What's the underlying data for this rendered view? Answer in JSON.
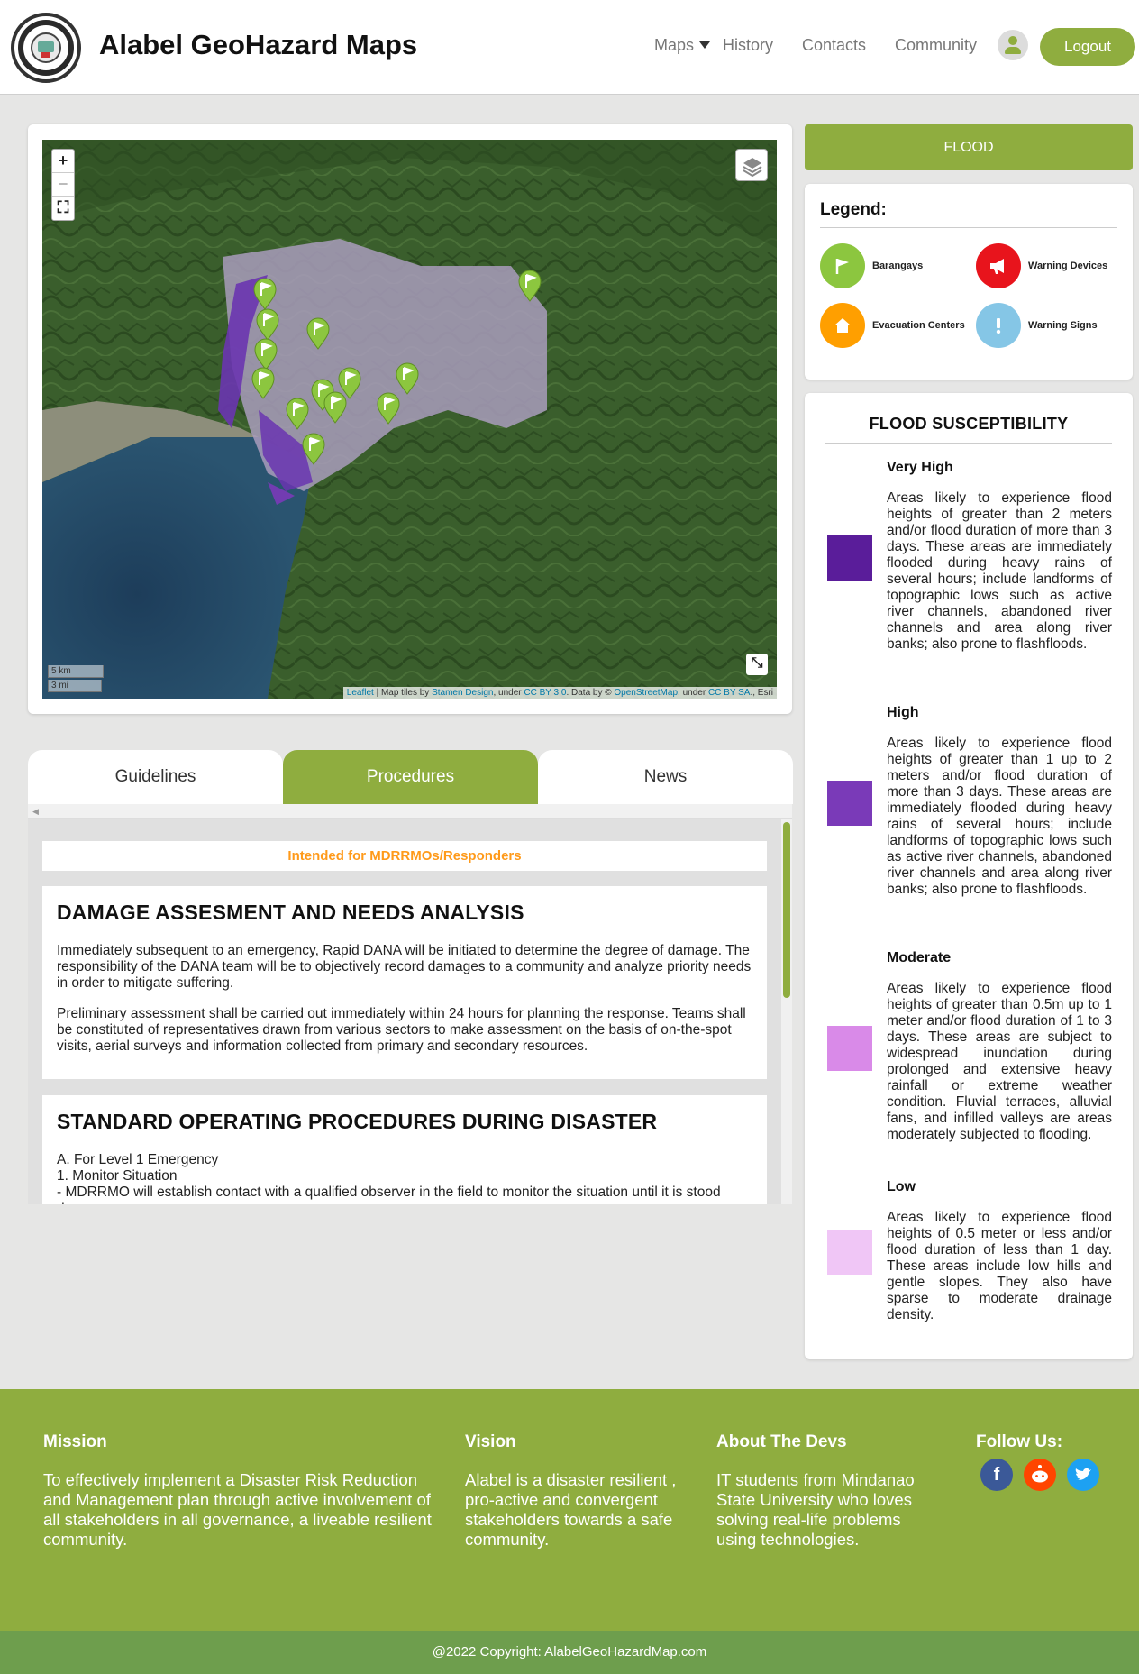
{
  "header": {
    "site_title": "Alabel GeoHazard Maps",
    "nav": {
      "maps": "Maps",
      "history": "History",
      "contacts": "Contacts",
      "community": "Community"
    },
    "logout": "Logout"
  },
  "map": {
    "zoom_in": "+",
    "zoom_out": "−",
    "scale_km": "5 km",
    "scale_mi": "3 mi",
    "attribution": {
      "leaflet": "Leaflet",
      "sep1": " | Map tiles by ",
      "stamen": "Stamen Design",
      "sep2": ", under ",
      "ccby": "CC BY 3.0",
      "sep3": ". Data by © ",
      "osm": "OpenStreetMap",
      "sep4": ", under ",
      "ccbysa": "CC BY SA",
      "sep5": "., Esri"
    }
  },
  "tabs": {
    "guidelines": "Guidelines",
    "procedures": "Procedures",
    "news": "News"
  },
  "procedures": {
    "intended": "Intended for MDRRMOs/Responders",
    "section1": {
      "title": "DAMAGE ASSESMENT AND NEEDS ANALYSIS",
      "p1": "Immediately subsequent to an emergency, Rapid DANA will be initiated to determine the degree of damage. The responsibility of the DANA team will be to objectively record damages to a community and analyze priority needs in order to mitigate suffering.",
      "p2": "Preliminary assessment shall be carried out immediately within 24 hours for planning the response. Teams shall be constituted of representatives drawn from various sectors to make assessment on the basis of on-the-spot visits, aerial surveys and information collected from primary and secondary resources."
    },
    "section2": {
      "title": "STANDARD OPERATING PROCEDURES DURING DISASTER",
      "l1": "A. For Level 1 Emergency",
      "l2": "1. Monitor Situation",
      "l3": "- MDRRMO will establish contact with a qualified observer in the field to monitor the situation until it is stood down."
    }
  },
  "sidebar": {
    "flood_button": "FLOOD",
    "legend": {
      "title": "Legend:",
      "items": [
        {
          "label": "Barangays",
          "color": "#8cc63f",
          "icon": "flag-icon"
        },
        {
          "label": "Warning Devices",
          "color": "#e8141c",
          "icon": "megaphone-icon"
        },
        {
          "label": "Evacuation Centers",
          "color": "#ff9f00",
          "icon": "home-icon"
        },
        {
          "label": "Warning Signs",
          "color": "#85c6e6",
          "icon": "exclamation-icon"
        }
      ]
    },
    "susceptibility": {
      "title": "FLOOD SUSCEPTIBILITY",
      "levels": [
        {
          "name": "Very High",
          "color": "#5a1d9a",
          "desc": "Areas likely to experience flood heights of greater than 2 meters and/or flood duration of more than 3 days. These areas are immediately flooded during heavy rains of several hours; include landforms of topographic lows such as active river channels, abandoned river channels and area along river banks; also prone to flashfloods."
        },
        {
          "name": "High",
          "color": "#7a3ab8",
          "desc": "Areas likely to experience flood heights of greater than 1 up to 2 meters and/or flood duration of more than 3 days. These areas are immediately flooded during heavy rains of several hours; include landforms of topographic lows such as active river channels, abandoned river channels and area along river banks; also prone to flashfloods."
        },
        {
          "name": "Moderate",
          "color": "#d98ae8",
          "desc": "Areas likely to experience flood heights of greater than 0.5m up to 1 meter and/or flood duration of 1 to 3 days. These areas are subject to widespread inundation during prolonged and extensive heavy rainfall or extreme weather condition. Fluvial terraces, alluvial fans, and infilled valleys are areas moderately subjected to flooding."
        },
        {
          "name": "Low",
          "color": "#f0c6f6",
          "desc": "Areas likely to experience flood heights of 0.5 meter or less and/or flood duration of less than 1 day. These areas include low hills and gentle slopes. They also have sparse to moderate drainage density."
        }
      ]
    }
  },
  "footer": {
    "mission_title": "Mission",
    "mission_text": "To effectively implement a Disaster Risk Reduction and Management plan through active involvement of all stakeholders in all governance, a liveable resilient community.",
    "vision_title": "Vision",
    "vision_text": "Alabel is a disaster resilient , pro-active and convergent stakeholders towards a safe community.",
    "devs_title": "About The Devs",
    "devs_text": "IT students from Mindanao State University who loves solving real-life problems using technologies.",
    "follow_title": "Follow Us:",
    "copyright": "@2022 Copyright: AlabelGeoHazardMap.com"
  }
}
